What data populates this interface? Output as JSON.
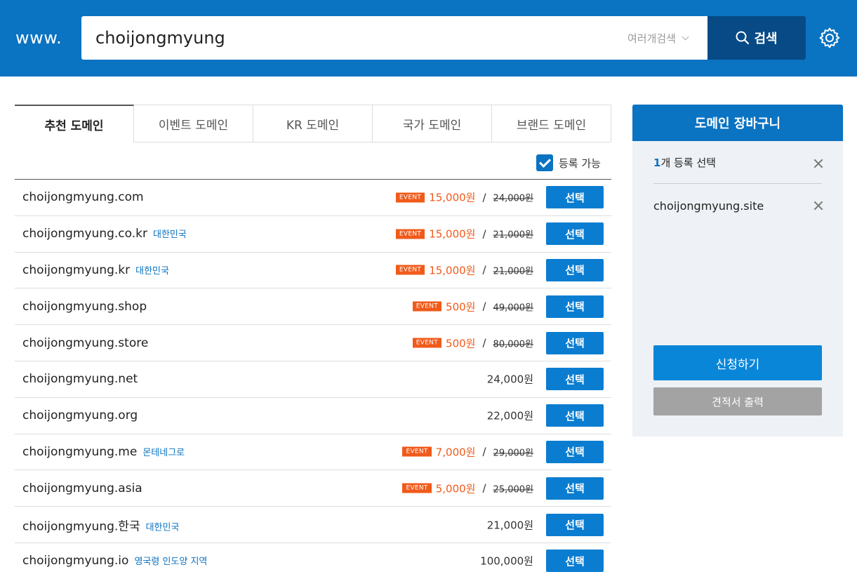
{
  "header": {
    "www_label": "www.",
    "search_value": "choijongmyung",
    "multi_search_label": "여러개검색",
    "search_button_label": "검색"
  },
  "tabs": [
    {
      "label": "추천 도메인",
      "active": true
    },
    {
      "label": "이벤트 도메인",
      "active": false
    },
    {
      "label": "KR 도메인",
      "active": false
    },
    {
      "label": "국가 도메인",
      "active": false
    },
    {
      "label": "브랜드 도메인",
      "active": false
    }
  ],
  "filter": {
    "available_label": "등록 가능",
    "checked": true
  },
  "select_label": "선택",
  "event_badge": "EVENT",
  "domains": [
    {
      "name": "choijongmyung.com",
      "country": "",
      "sale_price": "15,000원",
      "orig_price": "24,000원"
    },
    {
      "name": "choijongmyung.co.kr",
      "country": "대한민국",
      "sale_price": "15,000원",
      "orig_price": "21,000원"
    },
    {
      "name": "choijongmyung.kr",
      "country": "대한민국",
      "sale_price": "15,000원",
      "orig_price": "21,000원"
    },
    {
      "name": "choijongmyung.shop",
      "country": "",
      "sale_price": "500원",
      "orig_price": "49,000원"
    },
    {
      "name": "choijongmyung.store",
      "country": "",
      "sale_price": "500원",
      "orig_price": "80,000원"
    },
    {
      "name": "choijongmyung.net",
      "country": "",
      "price": "24,000원"
    },
    {
      "name": "choijongmyung.org",
      "country": "",
      "price": "22,000원"
    },
    {
      "name": "choijongmyung.me",
      "country": "몬테네그로",
      "sale_price": "7,000원",
      "orig_price": "29,000원"
    },
    {
      "name": "choijongmyung.asia",
      "country": "",
      "sale_price": "5,000원",
      "orig_price": "25,000원"
    },
    {
      "name": "choijongmyung.한국",
      "country": "대한민국",
      "price": "21,000원"
    },
    {
      "name": "choijongmyung.io",
      "country": "영국령 인도양 지역",
      "price": "100,000원"
    }
  ],
  "cart": {
    "title": "도메인 장바구니",
    "count": "1",
    "count_suffix": "개 등록 선택",
    "items": [
      "choijongmyung.site"
    ],
    "apply_label": "신청하기",
    "quote_label": "견적서 출력"
  },
  "colors": {
    "brand": "#0a73c2",
    "event": "#f05a1a"
  }
}
